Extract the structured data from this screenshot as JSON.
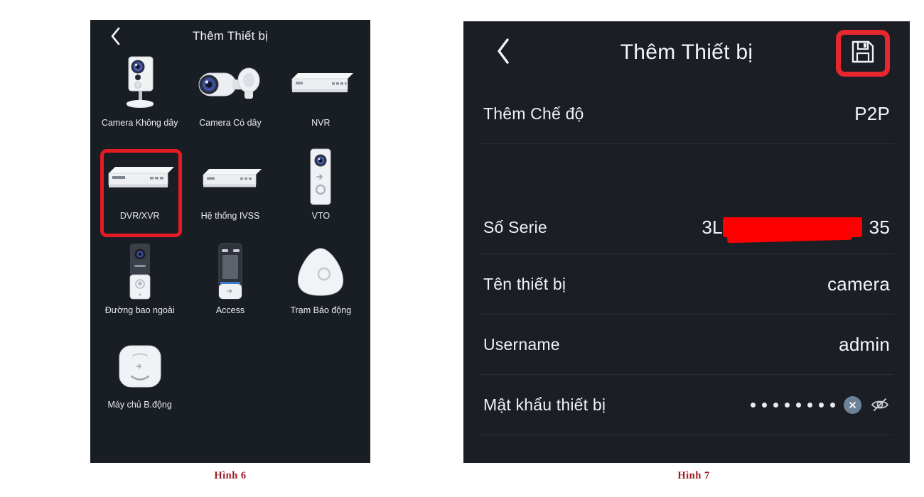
{
  "left_panel": {
    "header": {
      "back_icon": "chevron-left-icon",
      "title": "Thêm Thiết bị"
    },
    "items": [
      {
        "label": "Camera Không dây",
        "icon": "cube-camera-icon",
        "highlighted": false
      },
      {
        "label": "Camera Có dây",
        "icon": "bullet-camera-icon",
        "highlighted": false
      },
      {
        "label": "NVR",
        "icon": "nvr-box-icon",
        "highlighted": false
      },
      {
        "label": "DVR/XVR",
        "icon": "dvr-box-icon",
        "highlighted": true
      },
      {
        "label": "Hệ thống IVSS",
        "icon": "ivss-box-icon",
        "highlighted": false
      },
      {
        "label": "VTO",
        "icon": "vto-door-station-icon",
        "highlighted": false
      },
      {
        "label": "Đường bao ngoài",
        "icon": "outdoor-station-icon",
        "highlighted": false
      },
      {
        "label": "Access",
        "icon": "access-terminal-icon",
        "highlighted": false
      },
      {
        "label": "Trạm Báo động",
        "icon": "alarm-hub-icon",
        "highlighted": false
      },
      {
        "label": "Máy chủ B.động",
        "icon": "alarm-server-icon",
        "highlighted": false
      }
    ]
  },
  "right_panel": {
    "header": {
      "back_icon": "chevron-left-icon",
      "title": "Thêm Thiết bị",
      "save_icon": "save-floppy-icon"
    },
    "rows": [
      {
        "label": "Thêm Chế độ",
        "value": "P2P"
      },
      {
        "label": "Số Serie",
        "value_prefix": "3L",
        "value_suffix": "35",
        "redacted": true
      },
      {
        "label": "Tên thiết bị",
        "value": "camera"
      },
      {
        "label": "Username",
        "value": "admin"
      },
      {
        "label": "Mật khẩu thiết bị",
        "password_dots": 8,
        "clear_icon": "clear-circle-x-icon",
        "toggle_icon": "eye-slash-icon"
      }
    ]
  },
  "captions": {
    "left": "Hình  6",
    "right": "Hình  7"
  },
  "colors": {
    "panel_bg": "#191d24",
    "panel_bg_right": "#1b1e24",
    "highlight_red": "#e51b24",
    "redaction_red": "#fe0000",
    "caption_red": "#9b1c24",
    "text_primary": "#f0f2f6",
    "divider": "#2a2e36",
    "clear_button": "#6d8296"
  }
}
